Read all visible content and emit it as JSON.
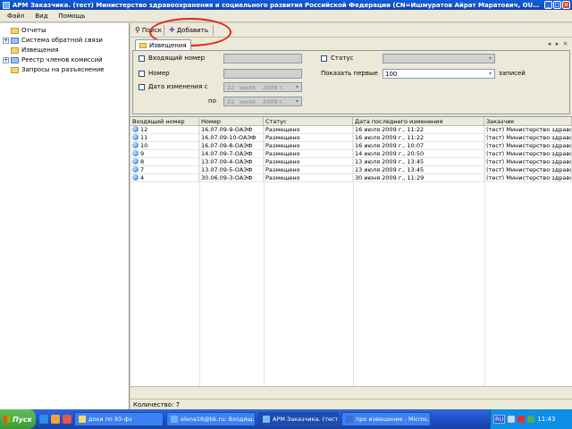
{
  "window": {
    "title": "АРМ Заказчика. (тест) Министерство здравоохранения и социального развития Российской Федерации (CN=Ишмуратов Айрат Маратович, OU=главный специал..."
  },
  "menu": [
    "Файл",
    "Вид",
    "Помощь"
  ],
  "tree": [
    {
      "label": "Отчеты",
      "expandable": false,
      "icon": "folder-icon"
    },
    {
      "label": "Система обратной связи",
      "expandable": true,
      "icon": "folder-icon"
    },
    {
      "label": "Извещения",
      "expandable": false,
      "icon": "folder-icon"
    },
    {
      "label": "Реестр членов комиссий",
      "expandable": true,
      "icon": "folder-icon"
    },
    {
      "label": "Запросы на разъяснение",
      "expandable": false,
      "icon": "folder-icon"
    }
  ],
  "toolbar": {
    "search_label": "Поиск",
    "add_label": "Добавить"
  },
  "tab": {
    "label": "Извещения"
  },
  "filters": {
    "incoming_number_label": "Входящий номер",
    "number_label": "Номер",
    "changed_date_label": "Дата изменения с",
    "to_label": "по",
    "date_from": {
      "day": "22",
      "month": "июля",
      "year": "2009 г."
    },
    "date_to": {
      "day": "22",
      "month": "июля",
      "year": "2009 г."
    },
    "status_label": "Статус",
    "show_first_label": "Показать первые",
    "show_first_value": "100",
    "records_label": "записей"
  },
  "grid": {
    "columns": [
      "Входящий номер",
      "Номер",
      "Статус",
      "Дата последнего изменения",
      "Заказчик"
    ],
    "rows": [
      [
        "12",
        "16.07.09-9-ОАЭФ",
        "Размещено",
        "16 июля 2009 г., 11:22",
        "(тест) Министерство здравоо"
      ],
      [
        "11",
        "16.07.09-10-ОАЭФ",
        "Размещено",
        "16 июля 2009 г., 11:22",
        "(тест) Министерство здравоо"
      ],
      [
        "10",
        "16.07.09-8-ОАЭФ",
        "Размещено",
        "16 июля 2009 г., 10:07",
        "(тест) Министерство здравоо"
      ],
      [
        "9",
        "14.07.09-7-ОАЭФ",
        "Размещено",
        "14 июля 2009 г., 20:50",
        "(тест) Министерство здравоо"
      ],
      [
        "8",
        "13.07.09-4-ОАЭФ",
        "Размещено",
        "13 июля 2009 г., 13:45",
        "(тест) Министерство здравоо"
      ],
      [
        "7",
        "13.07.09-5-ОАЭФ",
        "Размещено",
        "13 июля 2009 г., 13:45",
        "(тест) Министерство здравоо"
      ],
      [
        "4",
        "30.06.09-3-ОАЭФ",
        "Размещено",
        "30 июня 2009 г., 11:29",
        "(тест) Министерство здравоо"
      ]
    ]
  },
  "status": {
    "count_label": "Количество: 7"
  },
  "taskbar": {
    "start_label": "Пуск",
    "tasks": [
      {
        "label": "доки по 93-фз",
        "active": false
      },
      {
        "label": "elena16@bk.ru: Входящ...",
        "active": false
      },
      {
        "label": "АРМ Заказчика. (тест...",
        "active": true
      },
      {
        "label": "про извещение - Micros...",
        "active": false
      }
    ],
    "lang": "RU",
    "clock": "11:43"
  },
  "colors": {
    "highlight_oval": "#e0281c",
    "titlebar": "#0a5fd8",
    "taskbar": "#245edb"
  }
}
